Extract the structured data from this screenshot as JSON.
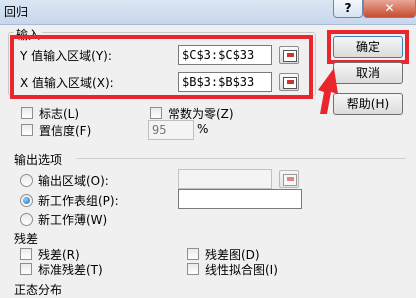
{
  "window": {
    "title": "回归",
    "help_icon": "question-icon",
    "close_icon": "close-icon"
  },
  "input_group": {
    "legend": "输入",
    "y_label": "Y 值输入区域(Y):",
    "y_value": "$C$3:$C$33",
    "x_label": "X 值输入区域(X):",
    "x_value": "$B$3:$B$33",
    "labels_checkbox": "标志(L)",
    "constant_zero_checkbox": "常数为零(Z)",
    "confidence_checkbox": "置信度(F)",
    "confidence_value": "95",
    "percent": "%"
  },
  "buttons": {
    "ok": "确定",
    "cancel": "取消",
    "help": "帮助(H)"
  },
  "output_group": {
    "legend": "输出选项",
    "output_range": "输出区域(O):",
    "new_worksheet": "新工作表组(P):",
    "new_workbook": "新工作薄(W)",
    "selected": "new_worksheet"
  },
  "residuals": {
    "legend": "残差",
    "residuals": "残差(R)",
    "standardized": "标准残差(T)",
    "residual_plots": "残差图(D)",
    "line_fit_plots": "线性拟合图(I)"
  },
  "normal_probability": {
    "legend": "正态分布"
  },
  "annotations": {
    "highlight_color": "#e8262c"
  }
}
